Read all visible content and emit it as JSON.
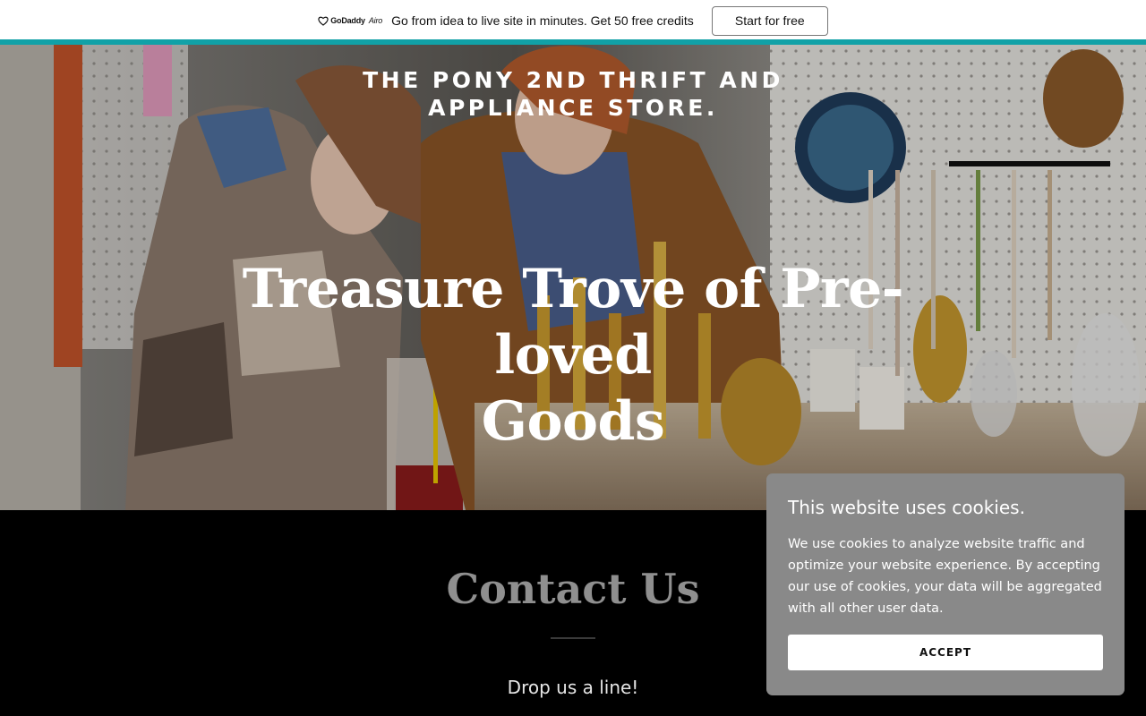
{
  "promo": {
    "brand": "GoDaddy",
    "brand_suffix": "Airo",
    "text": "Go from idea to live site in minutes. Get 50 free credits",
    "cta_label": "Start for free",
    "accent_color": "#11a1a7"
  },
  "hero": {
    "store_name_line1": "THE PONY 2ND THRIFT AND",
    "store_name_line2": "APPLIANCE STORE.",
    "title_line1": "Treasure Trove of Pre-loved",
    "title_line2": "Goods"
  },
  "contact": {
    "title": "Contact Us",
    "subtitle": "Drop us a line!"
  },
  "cookie": {
    "title": "This website uses cookies.",
    "body": "We use cookies to analyze website traffic and optimize your website experience. By accepting our use of cookies, your data will be aggregated with all other user data.",
    "accept_label": "ACCEPT"
  }
}
